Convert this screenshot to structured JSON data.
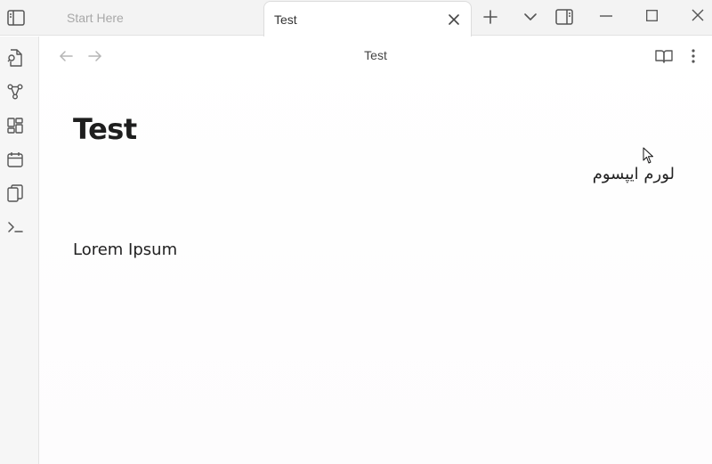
{
  "tabs": [
    {
      "label": "Start Here",
      "active": false
    },
    {
      "label": "Test",
      "active": true
    }
  ],
  "titlebar": {
    "icons": [
      "sidebar-toggle-icon",
      "new-tab-icon",
      "tab-list-icon",
      "right-sidebar-icon",
      "minimize-icon",
      "maximize-icon",
      "close-window-icon"
    ]
  },
  "ribbon": {
    "icons": [
      "open-quick-switcher-icon",
      "graph-view-icon",
      "canvas-icon",
      "daily-note-icon",
      "templates-icon",
      "command-palette-icon"
    ]
  },
  "view": {
    "title": "Test",
    "actions": [
      "reading-view-icon",
      "more-options-icon"
    ]
  },
  "document": {
    "heading": "Test",
    "rtl_text": "لورم ایپسوم",
    "paragraph": "Lorem Ipsum"
  },
  "colors": {
    "titlebar_bg": "#f3f3f3",
    "ribbon_bg": "#f6f6f6",
    "text": "#222222",
    "muted": "#a8a8a8"
  }
}
